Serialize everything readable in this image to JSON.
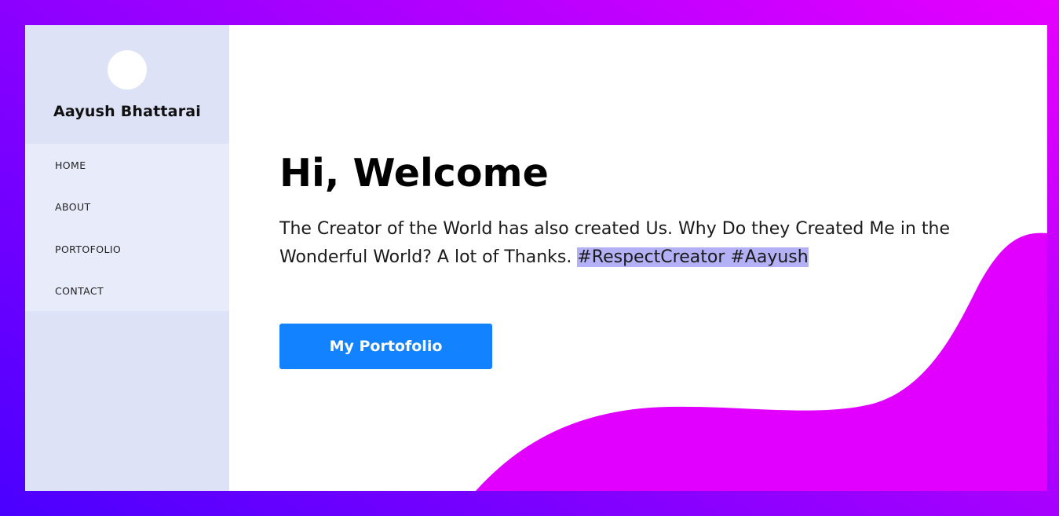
{
  "profile": {
    "name": "Aayush Bhattarai"
  },
  "nav": {
    "items": [
      {
        "label": "HOME"
      },
      {
        "label": "ABOUT"
      },
      {
        "label": "PORTOFOLIO"
      },
      {
        "label": "CONTACT"
      }
    ]
  },
  "hero": {
    "heading": "Hi, Welcome",
    "intro_text": "The Creator of the World has also created Us. Why Do they Created Me in the Wonderful World? A lot of Thanks. ",
    "highlighted_text": "#RespectCreator #Aayush",
    "cta_label": "My Portofolio"
  },
  "colors": {
    "background_gradient_start": "#4a00ff",
    "background_gradient_end": "#e600ff",
    "sidebar": "#dde2f6",
    "nav_panel": "#e8ebfa",
    "blob": "#e100ff",
    "button": "#1382ff",
    "highlight": "#b3b0f5"
  }
}
